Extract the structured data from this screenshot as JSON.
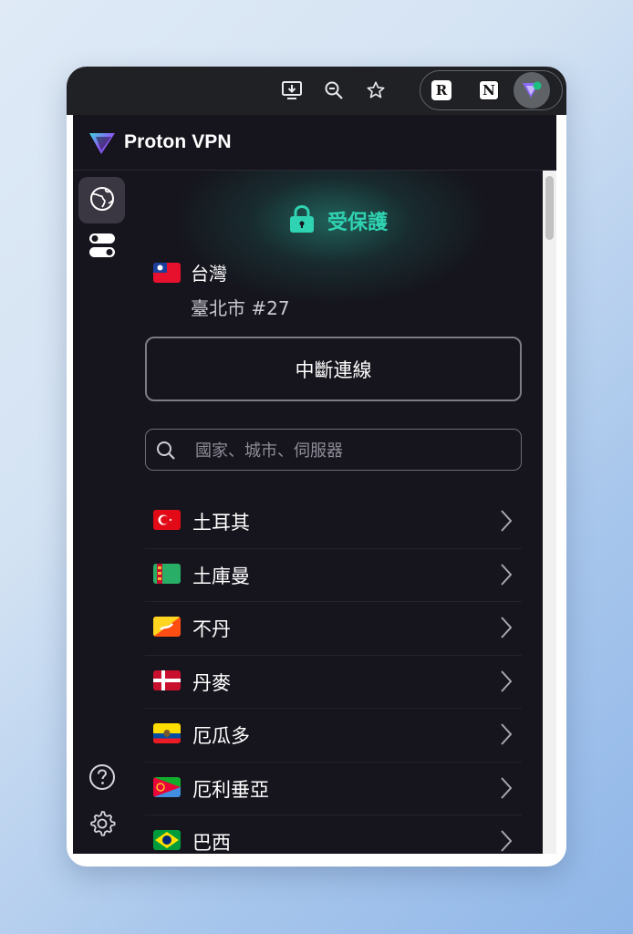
{
  "browser": {
    "toolbar_icons": [
      "install-app-icon",
      "zoom-out-icon",
      "bookmark-star-icon"
    ],
    "extensions": [
      {
        "name": "readwise-reader-extension",
        "glyph": "R"
      },
      {
        "name": "notion-extension",
        "glyph": "N"
      },
      {
        "name": "proton-vpn-extension",
        "glyph": ""
      }
    ]
  },
  "popup": {
    "brand": "Proton VPN",
    "status": {
      "text": "受保護",
      "color": "#2fd3b1"
    },
    "connection": {
      "country": "台灣",
      "server": "臺北市 #27"
    },
    "disconnect_label": "中斷連線",
    "search": {
      "placeholder": "國家、城市、伺服器",
      "value": ""
    },
    "countries": [
      {
        "name": "土耳其",
        "flag": "turkey"
      },
      {
        "name": "土庫曼",
        "flag": "turkmenistan"
      },
      {
        "name": "不丹",
        "flag": "bhutan"
      },
      {
        "name": "丹麥",
        "flag": "denmark"
      },
      {
        "name": "厄瓜多",
        "flag": "ecuador"
      },
      {
        "name": "厄利垂亞",
        "flag": "eritrea"
      },
      {
        "name": "巴西",
        "flag": "brazil"
      }
    ],
    "sidebar": {
      "top": [
        "globe-icon",
        "toggles-icon"
      ],
      "bottom": [
        "help-icon",
        "settings-gear-icon"
      ]
    }
  }
}
